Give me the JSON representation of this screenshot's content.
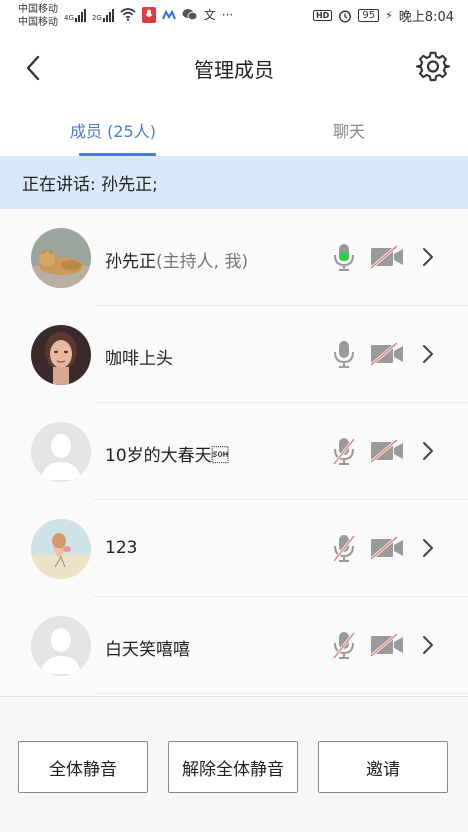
{
  "status_bar": {
    "carrier1": "中国移动",
    "carrier2": "中国移动",
    "net1": "4G",
    "net2": "2G",
    "hd": "HD",
    "battery": "95",
    "time": "晚上8:04",
    "dots": "···"
  },
  "header": {
    "title": "管理成员"
  },
  "tabs": [
    {
      "label": "成员 (25人)",
      "active": true
    },
    {
      "label": "聊天",
      "active": false
    }
  ],
  "speaking": "正在讲话: 孙先正;",
  "members": [
    {
      "name": "孙先正",
      "role": "(主持人, 我)",
      "mic": "active",
      "camera": "off",
      "avatar": "cat-photo"
    },
    {
      "name": "咖啡上头",
      "role": "",
      "mic": "on",
      "camera": "off",
      "avatar": "person-photo"
    },
    {
      "name": "10岁的大春天\u0001",
      "role": "",
      "mic": "muted",
      "camera": "off",
      "avatar": "default"
    },
    {
      "name": "123",
      "role": "",
      "mic": "muted",
      "camera": "off",
      "avatar": "illustration"
    },
    {
      "name": "白天笑嘻嘻",
      "role": "",
      "mic": "muted",
      "camera": "off",
      "avatar": "default"
    }
  ],
  "buttons": {
    "mute_all": "全体静音",
    "unmute_all": "解除全体静音",
    "invite": "邀请"
  },
  "colors": {
    "accent": "#4a7dd7",
    "speaking_bg": "#d9e8fb",
    "mic_active": "#2ecc40",
    "muted_slash": "#e07a6a",
    "icon_gray": "#9a9a9a"
  }
}
